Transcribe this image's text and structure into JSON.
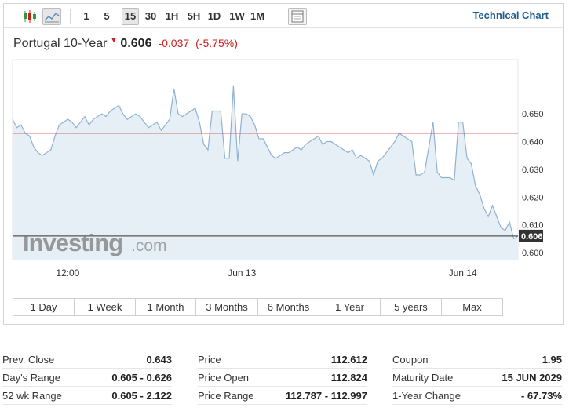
{
  "toolbar": {
    "periods": [
      "1",
      "5",
      "15",
      "30",
      "1H",
      "5H",
      "1D",
      "1W",
      "1M"
    ],
    "active_period": "15",
    "technical_chart": "Technical Chart"
  },
  "header": {
    "name": "Portugal 10-Year",
    "price": "0.606",
    "change": "-0.037",
    "change_pct": "(-5.75%)",
    "colors": {
      "negative": "#d01c1c",
      "link": "#1f5e8d"
    }
  },
  "watermark": {
    "brand": "Investing",
    "suffix": ".com"
  },
  "chart_data": {
    "type": "area",
    "x_ticks": [
      {
        "label": "12:00",
        "index": 13
      },
      {
        "label": "Jun 13",
        "index": 54
      },
      {
        "label": "Jun 14",
        "index": 106
      }
    ],
    "y_ticks": [
      0.6,
      0.61,
      0.62,
      0.63,
      0.64,
      0.65
    ],
    "y_tick_labels": [
      "0.600",
      "0.610",
      "0.620",
      "0.630",
      "0.640",
      "0.650"
    ],
    "ylim": [
      0.5975,
      0.6695
    ],
    "grid": false,
    "prev_close_line": 0.643,
    "last_price_line": 0.606,
    "last_price_label": "0.606",
    "colors": {
      "line": "#8fb2d2",
      "fill": "#e6eff5",
      "prev_close": "#c94040",
      "last": "#555555"
    },
    "values": [
      0.648,
      0.645,
      0.646,
      0.643,
      0.642,
      0.638,
      0.636,
      0.635,
      0.636,
      0.637,
      0.642,
      0.646,
      0.647,
      0.648,
      0.647,
      0.645,
      0.647,
      0.649,
      0.646,
      0.648,
      0.649,
      0.65,
      0.649,
      0.651,
      0.652,
      0.653,
      0.65,
      0.648,
      0.649,
      0.65,
      0.649,
      0.647,
      0.645,
      0.646,
      0.647,
      0.644,
      0.646,
      0.648,
      0.659,
      0.65,
      0.649,
      0.65,
      0.651,
      0.652,
      0.647,
      0.639,
      0.637,
      0.651,
      0.651,
      0.651,
      0.634,
      0.634,
      0.66,
      0.633,
      0.65,
      0.65,
      0.649,
      0.646,
      0.641,
      0.641,
      0.638,
      0.635,
      0.634,
      0.635,
      0.636,
      0.636,
      0.637,
      0.638,
      0.637,
      0.639,
      0.64,
      0.641,
      0.642,
      0.639,
      0.64,
      0.64,
      0.639,
      0.638,
      0.637,
      0.636,
      0.637,
      0.634,
      0.635,
      0.634,
      0.633,
      0.628,
      0.633,
      0.634,
      0.636,
      0.638,
      0.64,
      0.643,
      0.642,
      0.641,
      0.64,
      0.628,
      0.628,
      0.629,
      0.638,
      0.647,
      0.629,
      0.627,
      0.627,
      0.627,
      0.626,
      0.647,
      0.647,
      0.634,
      0.632,
      0.624,
      0.621,
      0.616,
      0.613,
      0.617,
      0.613,
      0.609,
      0.608,
      0.611,
      0.605,
      0.606
    ]
  },
  "ranges": [
    "1 Day",
    "1 Week",
    "1 Month",
    "3 Months",
    "6 Months",
    "1 Year",
    "5 years",
    "Max"
  ],
  "stats": [
    {
      "label": "Prev. Close",
      "value": "0.643"
    },
    {
      "label": "Day's Range",
      "value": "0.605 - 0.626"
    },
    {
      "label": "52 wk Range",
      "value": "0.605 - 2.122"
    },
    {
      "label": "Price",
      "value": "112.612"
    },
    {
      "label": "Price Open",
      "value": "112.824"
    },
    {
      "label": "Price Range",
      "value": "112.787 - 112.997"
    },
    {
      "label": "Coupon",
      "value": "1.95"
    },
    {
      "label": "Maturity Date",
      "value": "15 JUN 2029"
    },
    {
      "label": "1-Year Change",
      "value": "- 67.73%"
    }
  ]
}
